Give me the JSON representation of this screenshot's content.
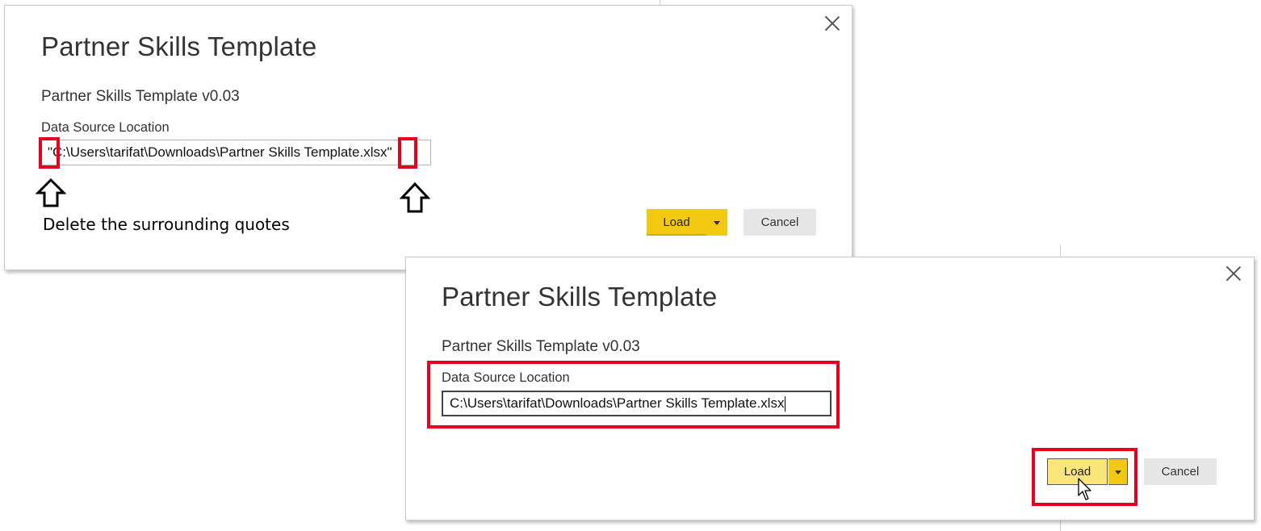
{
  "dialog_before": {
    "title": "Partner Skills Template",
    "subtitle": "Partner Skills Template v0.03",
    "field_label": "Data Source Location",
    "field_value": "\"C:\\Users\\tarifat\\Downloads\\Partner Skills Template.xlsx\"",
    "load_label": "Load",
    "cancel_label": "Cancel",
    "close_icon": "close-icon"
  },
  "dialog_after": {
    "title": "Partner Skills Template",
    "subtitle": "Partner Skills Template v0.03",
    "field_label": "Data Source Location",
    "field_value": "C:\\Users\\tarifat\\Downloads\\Partner Skills Template.xlsx",
    "load_label": "Load",
    "cancel_label": "Cancel",
    "close_icon": "close-icon"
  },
  "annotation": {
    "text": "Delete the surrounding quotes",
    "arrow_icon": "up-arrow-icon",
    "highlight_color": "#e8001c"
  },
  "colors": {
    "load_button": "#f2c811",
    "load_button_hover": "#fbe67a",
    "cancel_button": "#e6e6e6"
  }
}
